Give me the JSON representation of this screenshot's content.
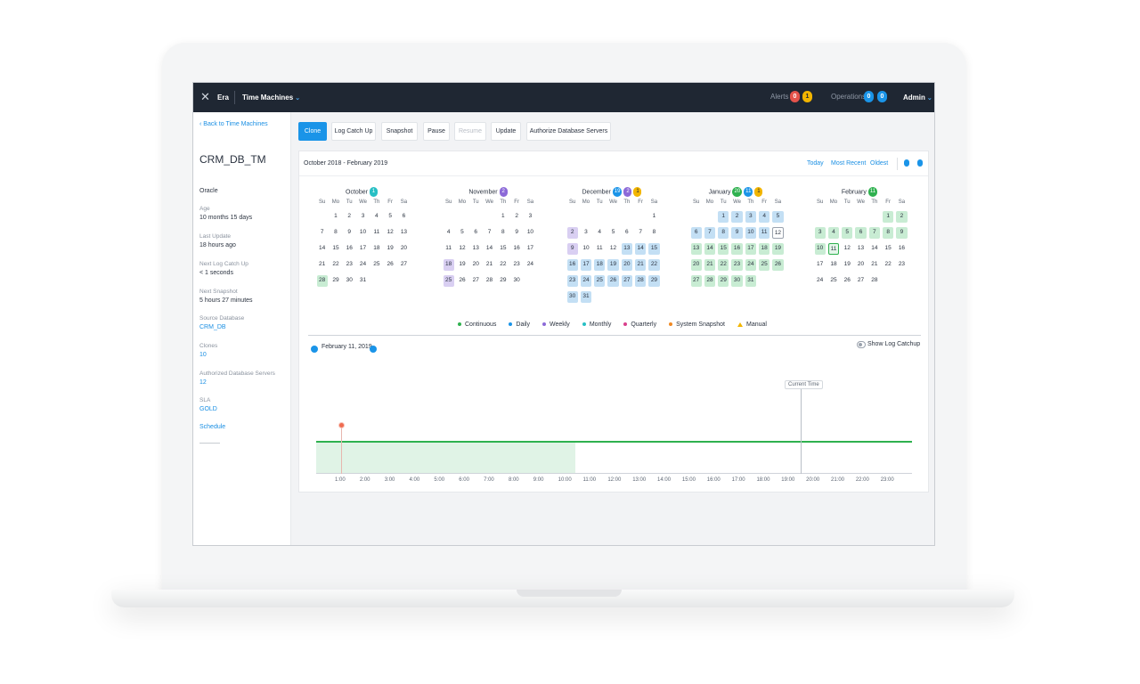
{
  "topbar": {
    "app_name": "Era",
    "module": "Time Machines",
    "alerts_label": "Alerts",
    "alerts_critical": "0",
    "alerts_warning": "1",
    "operations_label": "Operations",
    "operations_a": "0",
    "operations_b": "0",
    "user": "Admin"
  },
  "sidebar": {
    "back_link": "Back to Time Machines",
    "title": "CRM_DB_TM",
    "engine": "Oracle",
    "fields": [
      {
        "label": "Age",
        "value": "10 months 15 days"
      },
      {
        "label": "Last Update",
        "value": "18 hours ago"
      },
      {
        "label": "Next Log Catch Up",
        "value": "< 1 seconds"
      },
      {
        "label": "Next Snapshot",
        "value": "5 hours 27 minutes"
      },
      {
        "label": "Source Database",
        "value": "CRM_DB"
      },
      {
        "label": "Clones",
        "value": "10"
      },
      {
        "label": "Authorized Database Servers",
        "value": "12"
      },
      {
        "label": "SLA",
        "value": "GOLD"
      }
    ],
    "schedule": "Schedule"
  },
  "actions": {
    "clone": "Clone",
    "log_catch_up": "Log Catch Up",
    "snapshot": "Snapshot",
    "pause": "Pause",
    "resume": "Resume",
    "update": "Update",
    "authorize": "Authorize Database Servers"
  },
  "calendar": {
    "range": "October 2018 - February 2019",
    "today": "Today",
    "most_recent": "Most Recent",
    "oldest": "Oldest",
    "dow": [
      "Su",
      "Mo",
      "Tu",
      "We",
      "Th",
      "Fr",
      "Sa"
    ],
    "months": [
      {
        "name": "October",
        "badges": [
          {
            "v": "1",
            "c": "teal"
          }
        ],
        "offset": 1,
        "days": 31,
        "cont": [],
        "daily": [],
        "weekly": [],
        "boxed": [
          28
        ],
        "selected": [],
        "today": []
      },
      {
        "name": "November",
        "badges": [
          {
            "v": "2",
            "c": "purple"
          }
        ],
        "offset": 4,
        "days": 30,
        "cont": [],
        "daily": [],
        "weekly": [
          18,
          25
        ],
        "boxed": [],
        "selected": [],
        "today": []
      },
      {
        "name": "December",
        "badges": [
          {
            "v": "19",
            "c": "blue"
          },
          {
            "v": "2",
            "c": "purple"
          },
          {
            "v": "1",
            "c": "yellow"
          }
        ],
        "offset": 6,
        "days": 31,
        "cont": [],
        "daily": [
          13,
          14,
          15,
          16,
          17,
          18,
          19,
          20,
          21,
          22,
          23,
          24,
          25,
          26,
          27,
          28,
          29,
          30,
          31
        ],
        "weekly": [
          2,
          9
        ],
        "boxed": [],
        "selected": [],
        "today": []
      },
      {
        "name": "January",
        "badges": [
          {
            "v": "20",
            "c": "green"
          },
          {
            "v": "11",
            "c": "blue"
          },
          {
            "v": "1",
            "c": "yellow"
          }
        ],
        "offset": 2,
        "days": 31,
        "cont": [
          13,
          14,
          15,
          16,
          17,
          18,
          19,
          20,
          21,
          22,
          23,
          24,
          25,
          26,
          27,
          28,
          29,
          30,
          31
        ],
        "daily": [
          1,
          2,
          3,
          4,
          5,
          6,
          7,
          8,
          9,
          10,
          11
        ],
        "weekly": [],
        "boxed": [],
        "selected": [],
        "today": [
          12
        ]
      },
      {
        "name": "February",
        "badges": [
          {
            "v": "11",
            "c": "green"
          }
        ],
        "offset": 5,
        "days": 28,
        "cont": [
          1,
          2,
          3,
          4,
          5,
          6,
          7,
          8,
          9,
          10
        ],
        "daily": [],
        "weekly": [],
        "boxed": [],
        "selected": [
          11
        ],
        "today": []
      }
    ]
  },
  "legend": [
    {
      "label": "Continuous",
      "color": "#2fb14f",
      "shape": "dot"
    },
    {
      "label": "Daily",
      "color": "#1a94e8",
      "shape": "dot"
    },
    {
      "label": "Weekly",
      "color": "#8c6ad8",
      "shape": "dot"
    },
    {
      "label": "Monthly",
      "color": "#27bfc4",
      "shape": "dot"
    },
    {
      "label": "Quarterly",
      "color": "#d93f8c",
      "shape": "dot"
    },
    {
      "label": "System Snapshot",
      "color": "#f08a24",
      "shape": "dot"
    },
    {
      "label": "Manual",
      "color": "#f2b500",
      "shape": "triangle"
    }
  ],
  "timeline": {
    "date": "February 11, 2019",
    "show_log_catchup": "Show Log Catchup",
    "current_time": "Current Time",
    "ticks": [
      "1:00",
      "2:00",
      "3:00",
      "4:00",
      "5:00",
      "6:00",
      "7:00",
      "8:00",
      "9:00",
      "10:00",
      "11:00",
      "12:00",
      "13:00",
      "14:00",
      "15:00",
      "16:00",
      "17:00",
      "18:00",
      "19:00",
      "20:00",
      "21:00",
      "22:00",
      "23:00"
    ]
  }
}
